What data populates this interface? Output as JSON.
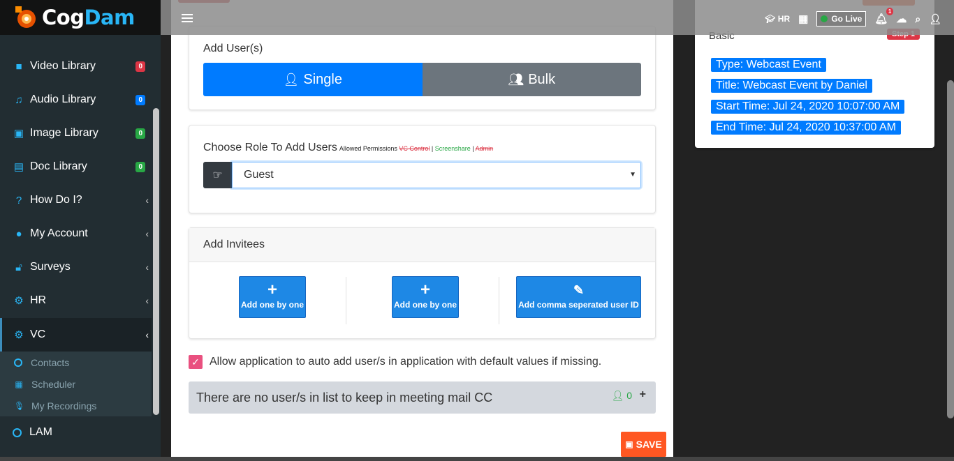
{
  "brand": {
    "logo_part1": "Cog",
    "logo_part2": "Dam"
  },
  "sidebar": {
    "items": [
      {
        "label": "Video Library",
        "icon": "video-icon",
        "badge": "0",
        "badge_color": "#dc3545"
      },
      {
        "label": "Audio Library",
        "icon": "music-icon",
        "badge": "0",
        "badge_color": "#007bff"
      },
      {
        "label": "Image Library",
        "icon": "image-icon",
        "badge": "0",
        "badge_color": "#28a745"
      },
      {
        "label": "Doc Library",
        "icon": "document-icon",
        "badge": "0",
        "badge_color": "#28a745"
      },
      {
        "label": "How Do I?",
        "icon": "question-icon"
      },
      {
        "label": "My Account",
        "icon": "user-icon"
      },
      {
        "label": "Surveys",
        "icon": "unlock-icon"
      },
      {
        "label": "HR",
        "icon": "gears-icon"
      },
      {
        "label": "VC",
        "icon": "gears-icon",
        "active": true
      }
    ],
    "submenu": [
      {
        "label": "Contacts",
        "icon": "circle-icon"
      },
      {
        "label": "Scheduler",
        "icon": "calendar-icon"
      },
      {
        "label": "My Recordings",
        "icon": "microphone-icon"
      }
    ],
    "lam_label": "LAM"
  },
  "topbar": {
    "hr_label": "HR",
    "golive_label": "Go Live",
    "notification_count": "1"
  },
  "add_users": {
    "title": "Add User(s)",
    "single_label": "Single",
    "bulk_label": "Bulk"
  },
  "role": {
    "title": "Choose Role To Add Users",
    "permissions_prefix": "Allowed Permissions",
    "perm_vc": "VC Control",
    "perm_screenshare": "Screenshare",
    "perm_admin": "Admin",
    "selected": "Guest"
  },
  "invitees": {
    "title": "Add Invitees",
    "button1": "Add one by one",
    "button2": "Add one by one",
    "button3": "Add comma seperated user ID"
  },
  "auto_add_label": "Allow application to auto add user/s in application with default values if missing.",
  "cc": {
    "message": "There are no user/s in list to keep in meeting mail CC",
    "count": "0"
  },
  "save_label": "SAVE",
  "info": {
    "section": "Basic",
    "step": "Step 1",
    "type": "Type: Webcast Event",
    "title": "Title: Webcast Event by Daniel",
    "start": "Start Time: Jul 24, 2020 10:07:00 AM",
    "end": "End Time: Jul 24, 2020 10:37:00 AM"
  },
  "colors": {
    "accent": "#007bff",
    "sidebar": "#222d32",
    "save": "#ff5722",
    "checkbox": "#e9507f"
  }
}
